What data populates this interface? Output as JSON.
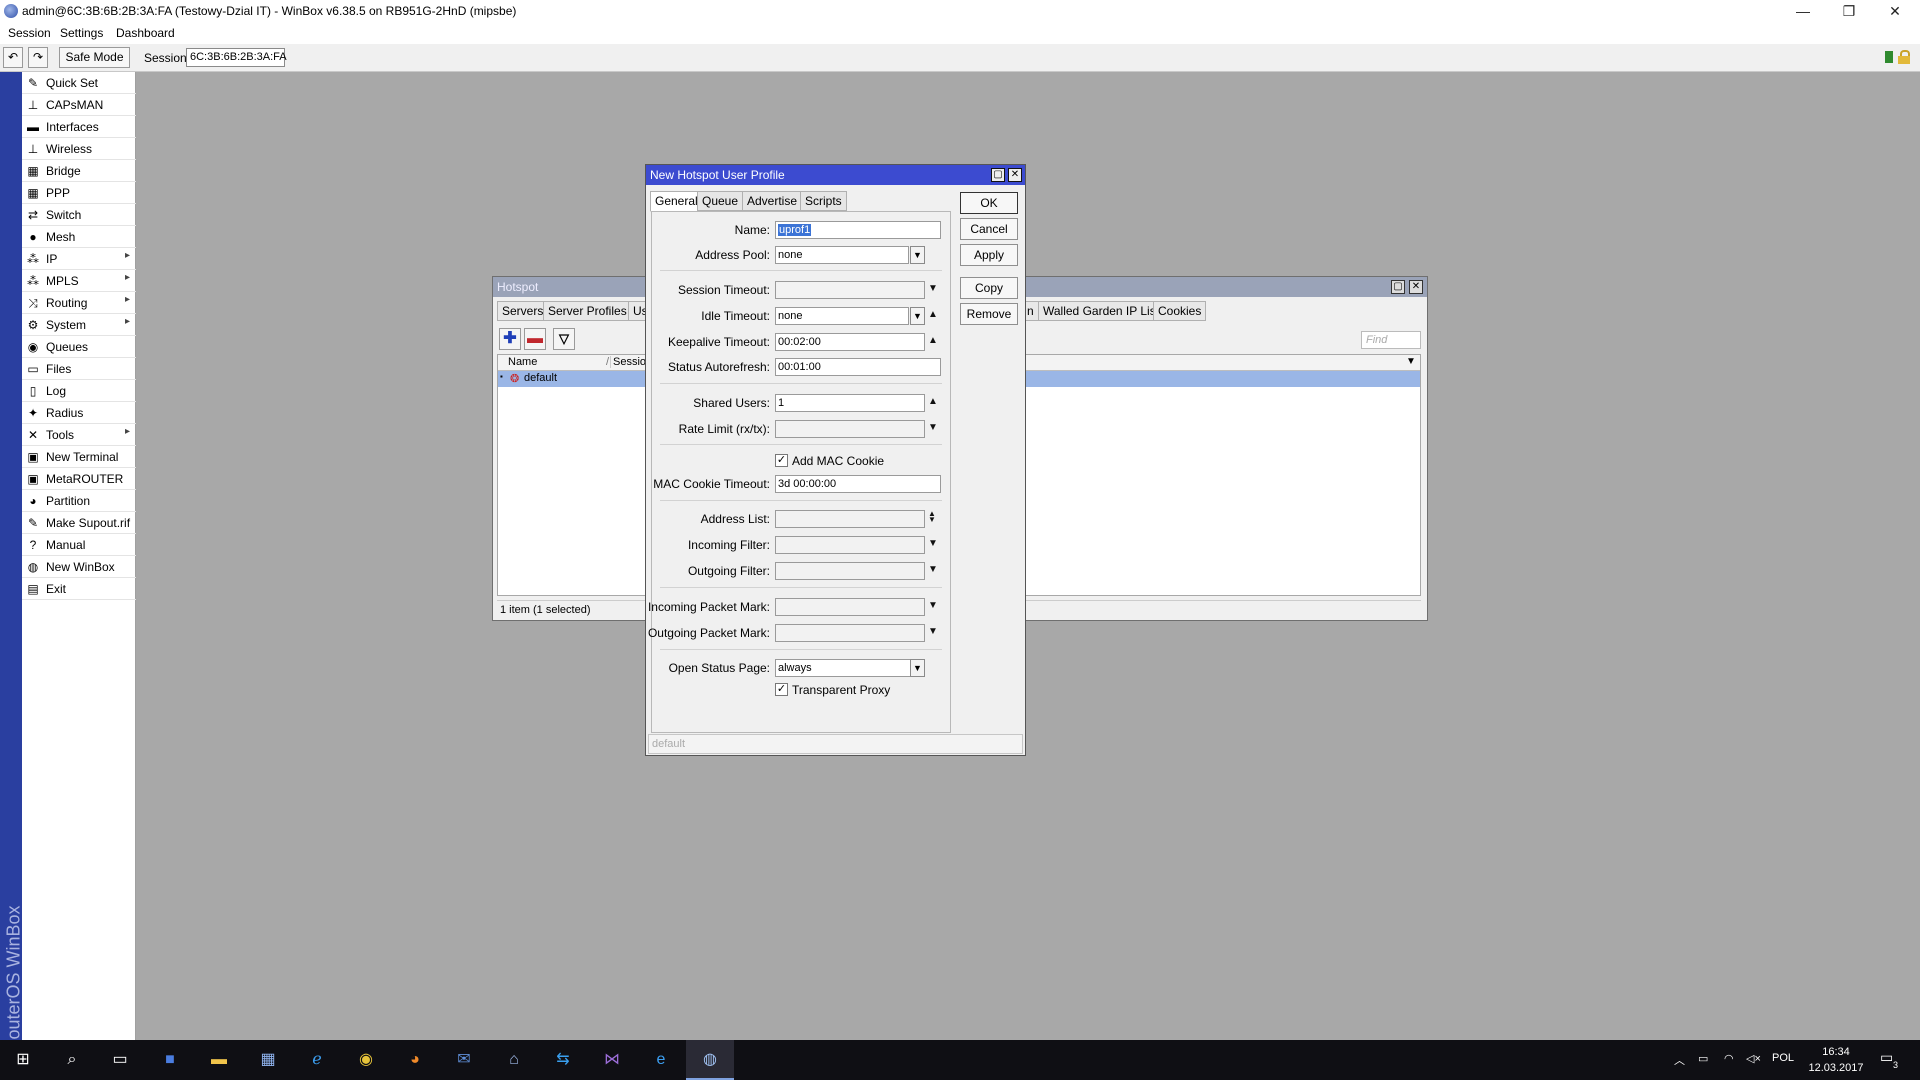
{
  "window": {
    "title": "admin@6C:3B:6B:2B:3A:FA (Testowy-Dzial IT) - WinBox v6.38.5 on RB951G-2HnD (mipsbe)",
    "min": "—",
    "max": "❐",
    "close": "✕"
  },
  "menu": [
    "Session",
    "Settings",
    "Dashboard"
  ],
  "toolbar": {
    "undo": "↶",
    "redo": "↷",
    "safe_mode": "Safe Mode",
    "session_label": "Session:",
    "session_value": "6C:3B:6B:2B:3A:FA"
  },
  "brand_vertical": "RouterOS WinBox",
  "sidebar": [
    {
      "label": "Quick Set",
      "icon": "quick-set-icon",
      "glyph": "✎",
      "arrow": false
    },
    {
      "label": "CAPsMAN",
      "icon": "capsman-icon",
      "glyph": "⊥",
      "arrow": false
    },
    {
      "label": "Interfaces",
      "icon": "interfaces-icon",
      "glyph": "▬",
      "arrow": false
    },
    {
      "label": "Wireless",
      "icon": "wireless-icon",
      "glyph": "⊥",
      "arrow": false
    },
    {
      "label": "Bridge",
      "icon": "bridge-icon",
      "glyph": "▦",
      "arrow": false
    },
    {
      "label": "PPP",
      "icon": "ppp-icon",
      "glyph": "▦",
      "arrow": false
    },
    {
      "label": "Switch",
      "icon": "switch-icon",
      "glyph": "⇄",
      "arrow": false
    },
    {
      "label": "Mesh",
      "icon": "mesh-icon",
      "glyph": "●",
      "arrow": false
    },
    {
      "label": "IP",
      "icon": "ip-icon",
      "glyph": "⁂",
      "arrow": true
    },
    {
      "label": "MPLS",
      "icon": "mpls-icon",
      "glyph": "⁂",
      "arrow": true
    },
    {
      "label": "Routing",
      "icon": "routing-icon",
      "glyph": "⤨",
      "arrow": true
    },
    {
      "label": "System",
      "icon": "system-icon",
      "glyph": "⚙",
      "arrow": true
    },
    {
      "label": "Queues",
      "icon": "queues-icon",
      "glyph": "◉",
      "arrow": false
    },
    {
      "label": "Files",
      "icon": "files-icon",
      "glyph": "▭",
      "arrow": false
    },
    {
      "label": "Log",
      "icon": "log-icon",
      "glyph": "▯",
      "arrow": false
    },
    {
      "label": "Radius",
      "icon": "radius-icon",
      "glyph": "✦",
      "arrow": false
    },
    {
      "label": "Tools",
      "icon": "tools-icon",
      "glyph": "✕",
      "arrow": true
    },
    {
      "label": "New Terminal",
      "icon": "terminal-icon",
      "glyph": "▣",
      "arrow": false
    },
    {
      "label": "MetaROUTER",
      "icon": "metarouter-icon",
      "glyph": "▣",
      "arrow": false
    },
    {
      "label": "Partition",
      "icon": "partition-icon",
      "glyph": "◕",
      "arrow": false
    },
    {
      "label": "Make Supout.rif",
      "icon": "supout-icon",
      "glyph": "✎",
      "arrow": false
    },
    {
      "label": "Manual",
      "icon": "manual-icon",
      "glyph": "?",
      "arrow": false
    },
    {
      "label": "New WinBox",
      "icon": "winbox-icon",
      "glyph": "◍",
      "arrow": false
    },
    {
      "label": "Exit",
      "icon": "exit-icon",
      "glyph": "▤",
      "arrow": false
    }
  ],
  "hotspot": {
    "title": "Hotspot",
    "tabs_left": [
      "Servers",
      "Server Profiles",
      "Us"
    ],
    "tabs_right": [
      "n",
      "Walled Garden IP List",
      "Cookies"
    ],
    "find_placeholder": "Find",
    "col_name": "Name",
    "col_session": "Session",
    "row_name": "default",
    "status": "1 item (1 selected)"
  },
  "dialog": {
    "title": "New Hotspot User Profile",
    "tabs": [
      "General",
      "Queue",
      "Advertise",
      "Scripts"
    ],
    "fields": {
      "name": {
        "label": "Name:",
        "value": "uprof1"
      },
      "address_pool": {
        "label": "Address Pool:",
        "value": "none"
      },
      "session_timeout": {
        "label": "Session Timeout:",
        "value": ""
      },
      "idle_timeout": {
        "label": "Idle Timeout:",
        "value": "none"
      },
      "keepalive_timeout": {
        "label": "Keepalive Timeout:",
        "value": "00:02:00"
      },
      "status_autorefresh": {
        "label": "Status Autorefresh:",
        "value": "00:01:00"
      },
      "shared_users": {
        "label": "Shared Users:",
        "value": "1"
      },
      "rate_limit": {
        "label": "Rate Limit (rx/tx):",
        "value": ""
      },
      "add_mac_cookie": {
        "label": "Add MAC Cookie",
        "checked": "✓"
      },
      "mac_cookie_timeout": {
        "label": "MAC Cookie Timeout:",
        "value": "3d 00:00:00"
      },
      "address_list": {
        "label": "Address List:",
        "value": ""
      },
      "incoming_filter": {
        "label": "Incoming Filter:",
        "value": ""
      },
      "outgoing_filter": {
        "label": "Outgoing Filter:",
        "value": ""
      },
      "incoming_packet_mark": {
        "label": "Incoming Packet Mark:",
        "value": ""
      },
      "outgoing_packet_mark": {
        "label": "Outgoing Packet Mark:",
        "value": ""
      },
      "open_status_page": {
        "label": "Open Status Page:",
        "value": "always"
      },
      "transparent_proxy": {
        "label": "Transparent Proxy",
        "checked": "✓"
      }
    },
    "buttons": {
      "ok": "OK",
      "cancel": "Cancel",
      "apply": "Apply",
      "copy": "Copy",
      "remove": "Remove"
    },
    "status": "default"
  },
  "taskbar": {
    "apps": [
      "start-icon",
      "search-icon",
      "task-view-icon",
      "save-icon",
      "file-explorer-icon",
      "network-tool-icon",
      "ie-icon",
      "chrome-icon",
      "firefox-icon",
      "thunderbird-icon",
      "remote-icon",
      "teamviewer-icon",
      "visual-studio-icon",
      "edge-icon",
      "winbox-taskbar-icon"
    ],
    "lang": "POL",
    "time": "16:34",
    "date": "12.03.2017",
    "notifications": "3"
  }
}
